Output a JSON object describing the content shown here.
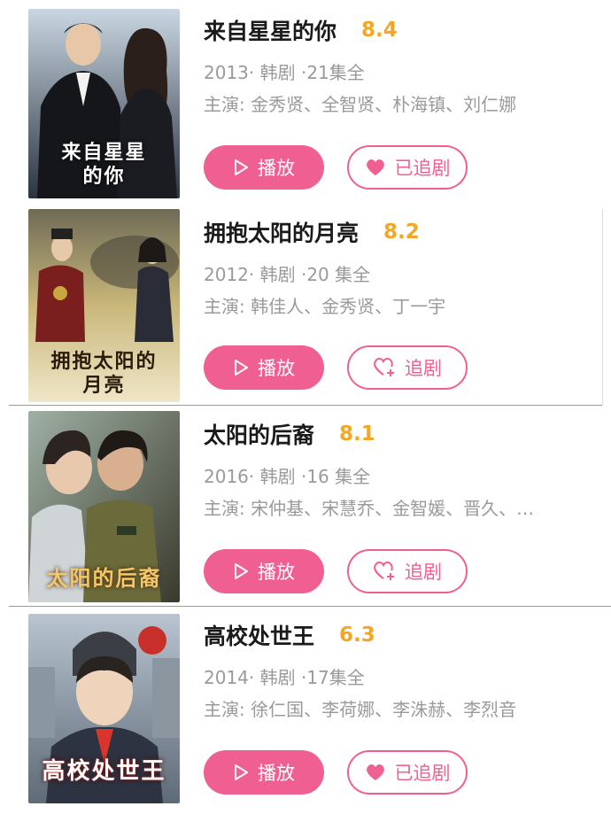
{
  "items": [
    {
      "title": "来自星星的你",
      "score": "8.4",
      "meta": "2013· 韩剧 ·21集全",
      "cast": "主演: 金秀贤、全智贤、朴海镇、刘仁娜",
      "poster_text": "来自星星\n的你",
      "play_label": "播放",
      "follow_label": "已追剧",
      "followed": true,
      "follow_icon": "heart-filled-icon"
    },
    {
      "title": "拥抱太阳的月亮",
      "score": "8.2",
      "meta": "2012· 韩剧 ·20 集全",
      "cast": "主演: 韩佳人、金秀贤、丁一宇",
      "poster_text": "拥抱太阳的\n月亮",
      "play_label": "播放",
      "follow_label": "追剧",
      "followed": false,
      "follow_icon": "heart-plus-icon"
    },
    {
      "title": "太阳的后裔",
      "score": "8.1",
      "meta": "2016· 韩剧 ·16 集全",
      "cast": "主演: 宋仲基、宋慧乔、金智媛、晋久、…",
      "poster_text": "太阳的后裔",
      "play_label": "播放",
      "follow_label": "追剧",
      "followed": false,
      "follow_icon": "heart-plus-icon"
    },
    {
      "title": "高校处世王",
      "score": "6.3",
      "meta": "2014· 韩剧 ·17集全",
      "cast": "主演: 徐仁国、李荷娜、李洙赫、李烈音",
      "poster_text": "高校处世王",
      "play_label": "播放",
      "follow_label": "已追剧",
      "followed": true,
      "follow_icon": "heart-filled-icon"
    }
  ],
  "colors": {
    "accent": "#f05f91",
    "score": "#f5a623",
    "secondary_text": "#9a9a9a"
  }
}
